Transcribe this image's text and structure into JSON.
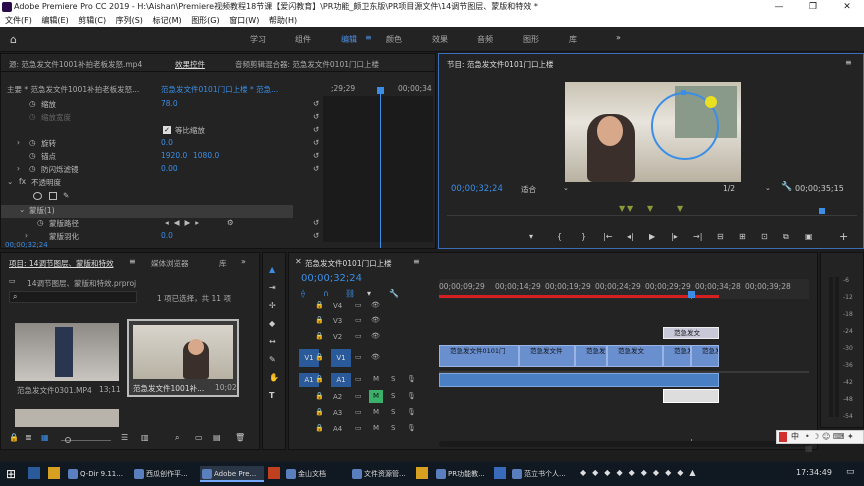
{
  "window": {
    "title": "Adobe Premiere Pro CC 2019 - H:\\Aishan\\Premiere视频教程18节课【爱闪教育】\\PR功能_颇卫东版\\PR项目源文件\\14调节图层、蒙版和特效 *",
    "minimize": "—",
    "maximize": "❐",
    "close": "✕"
  },
  "menu": [
    "文件(F)",
    "编辑(E)",
    "剪辑(C)",
    "序列(S)",
    "标记(M)",
    "图形(G)",
    "窗口(W)",
    "帮助(H)"
  ],
  "workspaces": [
    {
      "label": "学习"
    },
    {
      "label": "组件"
    },
    {
      "label": "编辑",
      "active": true
    },
    {
      "label": "颜色"
    },
    {
      "label": "效果"
    },
    {
      "label": "音频"
    },
    {
      "label": "图形"
    },
    {
      "label": "库"
    }
  ],
  "source_panel": {
    "tab_source": "源: 范急发文件1001补拍老板发怒.mp4",
    "tab_effects": "效果控件",
    "tab_audio": "音频剪辑混合器: 范急发文件0101门口上楼",
    "clip_path": "主要 * 范急发文件1001补拍老板发怒...",
    "clip_seq": "范急发文件0101门口上楼 * 范急...",
    "ruler_t1": ";29;29",
    "ruler_t2": "00;00;34",
    "props": [
      {
        "name": "缩放",
        "value": "78.0"
      },
      {
        "name": "缩放宽度",
        "value": ""
      },
      {
        "name": "",
        "value": "等比缩放"
      },
      {
        "name": "旋转",
        "value": "0.0"
      },
      {
        "name": "锚点",
        "value": "1920.0",
        "value2": "1080.0"
      },
      {
        "name": "防闪烁滤镜",
        "value": "0.00"
      },
      {
        "name": "不透明度",
        "value": ""
      },
      {
        "name": "蒙版(1)",
        "value": ""
      },
      {
        "name": "蒙版路径",
        "value": ""
      },
      {
        "name": "蒙版羽化",
        "value": "0.0"
      }
    ],
    "timecode": "00;00;32;24"
  },
  "program_monitor": {
    "tab": "节目: 范急发文件0101门口上楼",
    "timecode": "00;00;32;24",
    "fit": "适合",
    "quality": "1/2",
    "duration": "00;00;35;15"
  },
  "project_panel": {
    "tab": "项目: 14调节图层、蒙版和特效",
    "tab2": "媒体浏览器",
    "tab3": "库",
    "file": "14调节图层、蒙版和特效.prproj",
    "selection": "1 项已选择，共 11 项",
    "items": [
      {
        "name": "范急发文件0301.MP4",
        "duration": "13;11"
      },
      {
        "name": "范急发文件1001补...",
        "duration": "10;02"
      }
    ]
  },
  "timeline": {
    "tab": "范急发文件0101门口上楼",
    "timecode": "00;00;32;24",
    "ruler": [
      "00;00;09;29",
      "00;00;14;29",
      "00;00;19;29",
      "00;00;24;29",
      "00;00;29;29",
      "00;00;34;28",
      "00;00;39;28"
    ],
    "tracks": [
      {
        "label": "V4"
      },
      {
        "label": "V3"
      },
      {
        "label": "V2"
      },
      {
        "label": "V1",
        "src": "V1"
      },
      {
        "label": "A1",
        "src": "A1"
      },
      {
        "label": "A2"
      },
      {
        "label": "A3"
      },
      {
        "label": "A4"
      }
    ],
    "clips_v1": [
      "范急发文件0101门",
      "范急发文件",
      "范急发文件",
      "范急发文",
      "范急发文",
      "范急发文"
    ],
    "clip_v3": "范急发文",
    "meter": [
      "-6",
      "-12",
      "-18",
      "-24",
      "-30",
      "-36",
      "-42",
      "-48",
      "-54"
    ]
  },
  "ime": "中",
  "taskbar": {
    "items": [
      {
        "label": "Q-Dir 9.11..."
      },
      {
        "label": "西瓜创作平..."
      },
      {
        "label": "Adobe Pre...",
        "active": true
      },
      {
        "label": ""
      },
      {
        "label": "金山文档"
      },
      {
        "label": "文件资源管..."
      },
      {
        "label": "PR功能教..."
      },
      {
        "label": "范立书个人..."
      }
    ],
    "clock": "17:34:49"
  }
}
